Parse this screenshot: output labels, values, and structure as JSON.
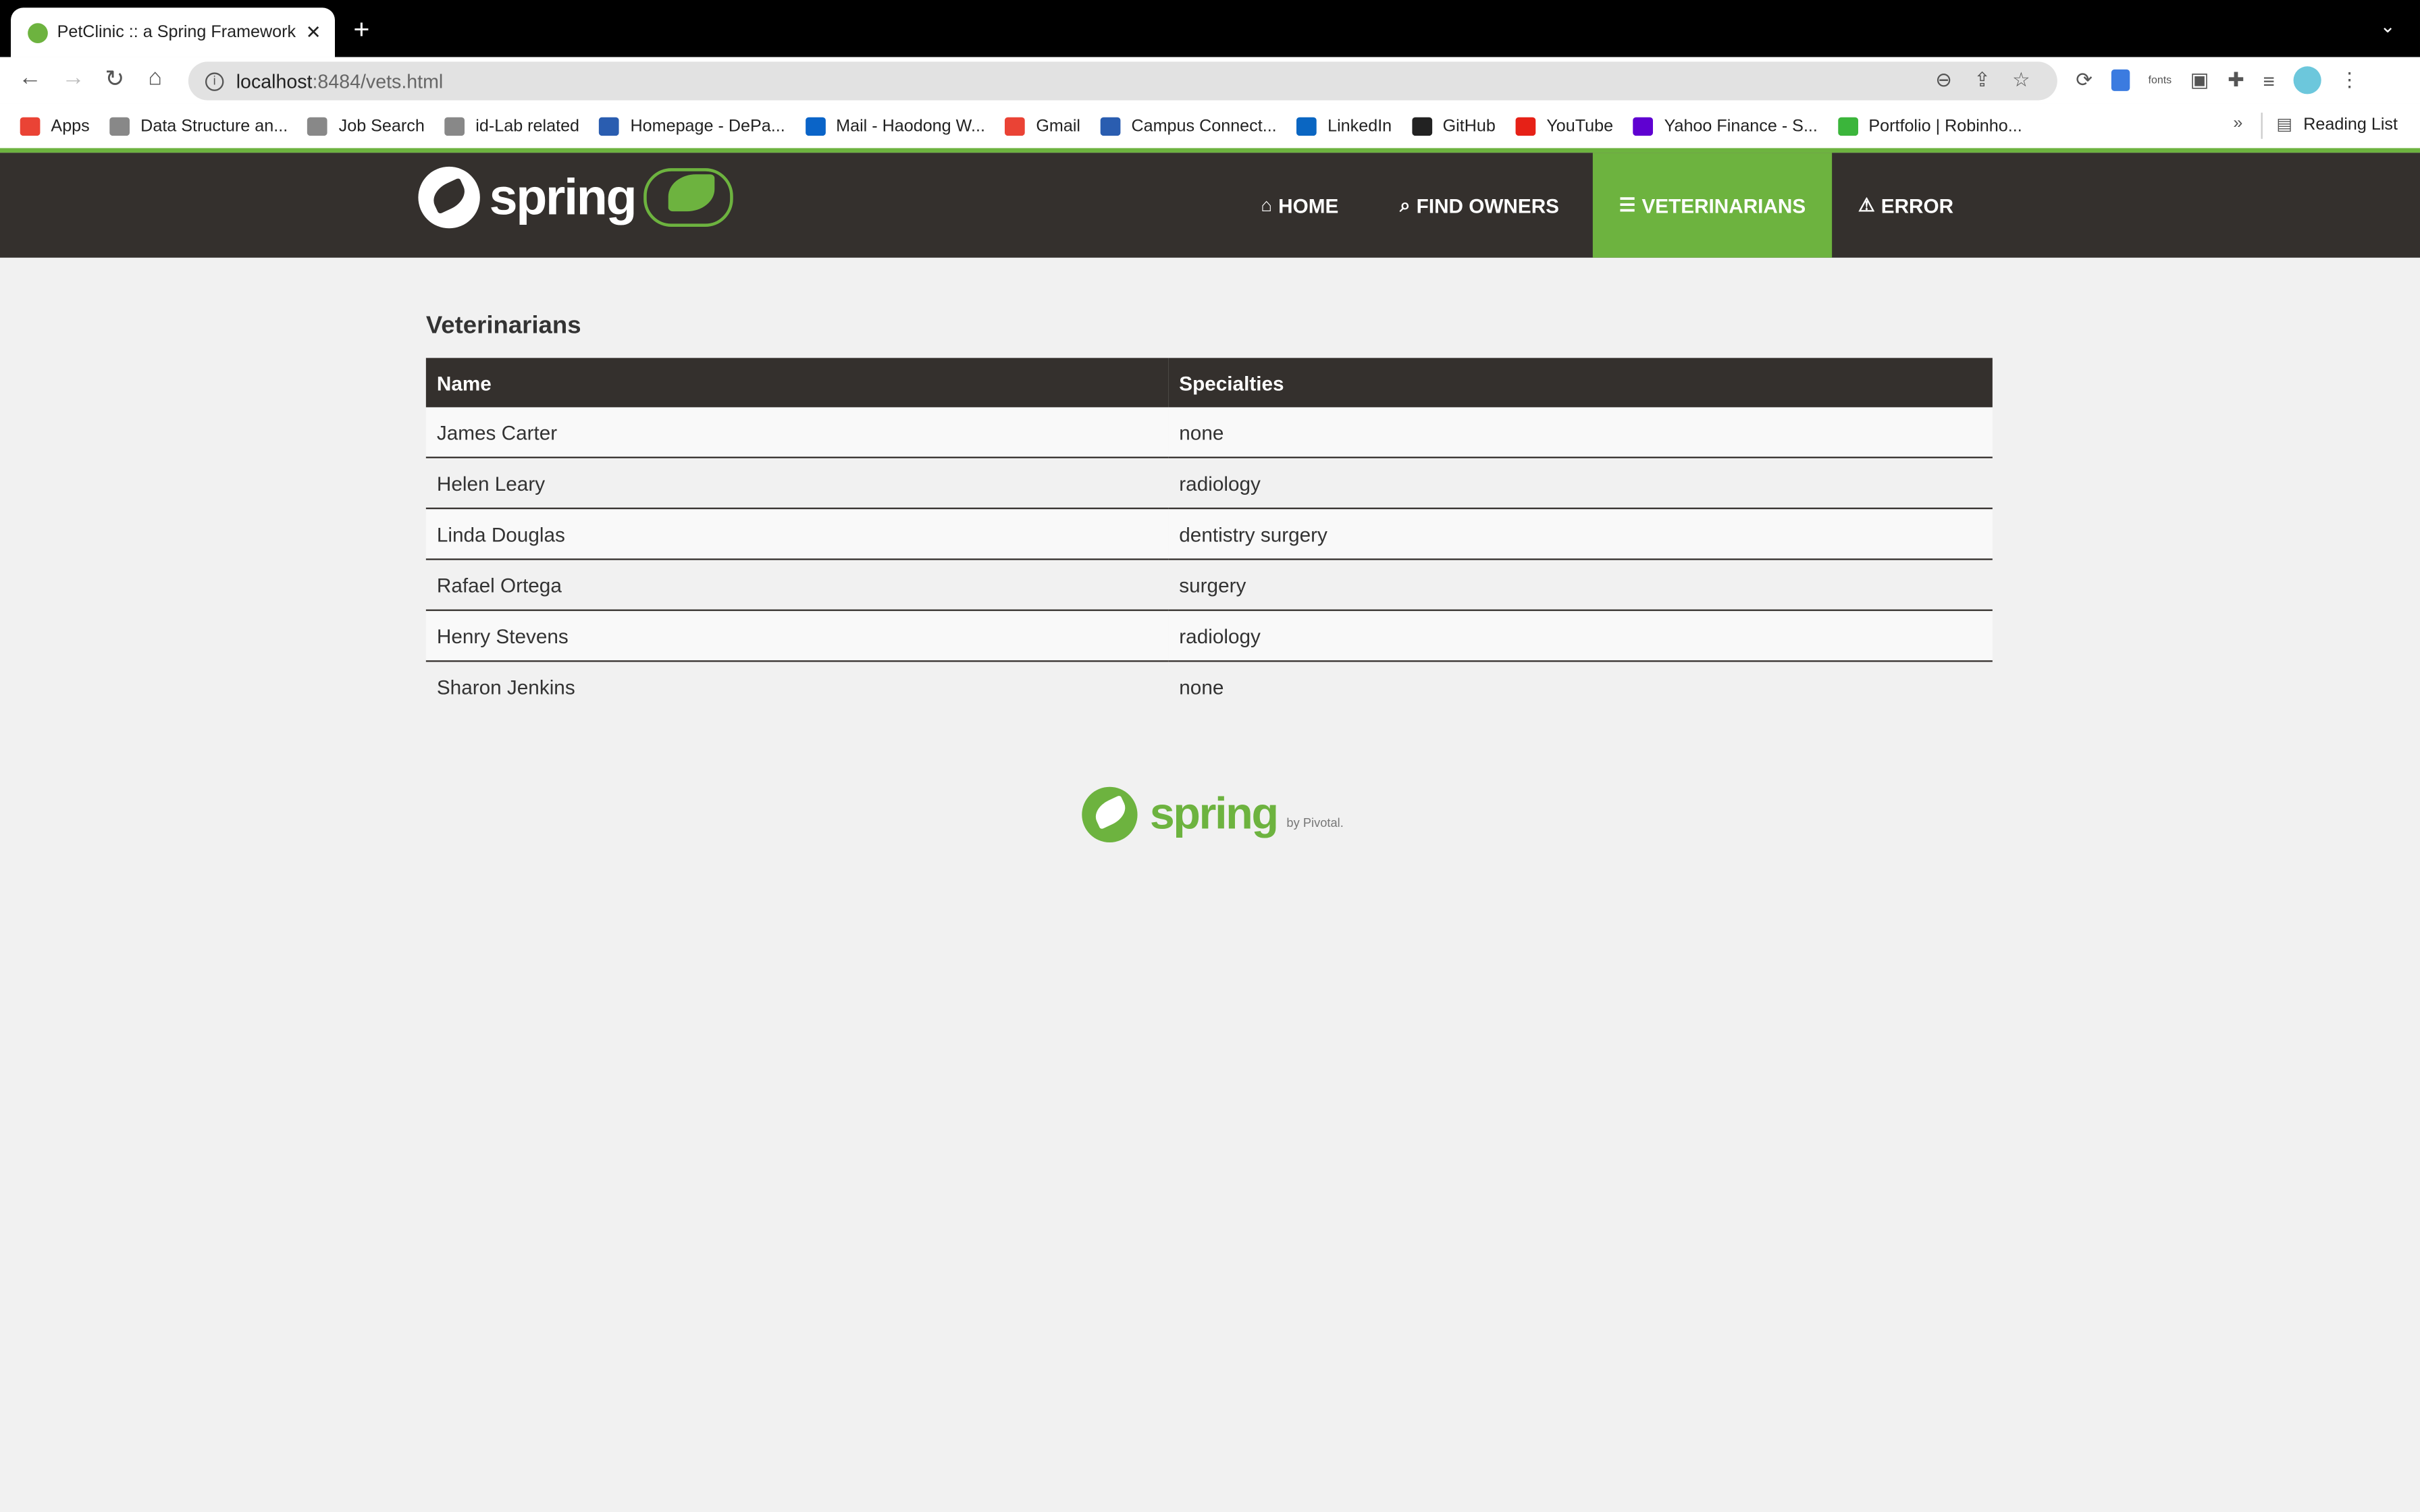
{
  "browser": {
    "tab_title": "PetClinic :: a Spring Framework demonstration",
    "url_host": "localhost",
    "url_path": ":8484/vets.html",
    "extension_label": "fonts",
    "bookmarks": [
      "Apps",
      "Data Structure an...",
      "Job Search",
      "id-Lab related",
      "Homepage - DePa...",
      "Mail - Haodong W...",
      "Gmail",
      "Campus Connect...",
      "LinkedIn",
      "GitHub",
      "YouTube",
      "Yahoo Finance - S...",
      "Portfolio | Robinho..."
    ],
    "bookmark_colors": [
      "#ea4335",
      "#888",
      "#888",
      "#888",
      "#2a5db0",
      "#0a64c8",
      "#ea4335",
      "#2a5db0",
      "#0a66c2",
      "#222",
      "#e62117",
      "#5f01d1",
      "#3bb53b"
    ],
    "overflow": "»",
    "reading_list": "Reading List"
  },
  "header": {
    "logo_text": "spring",
    "nav": [
      {
        "label": "HOME",
        "icon": "home-icon",
        "active": false
      },
      {
        "label": "FIND OWNERS",
        "icon": "search-icon",
        "active": false
      },
      {
        "label": "VETERINARIANS",
        "icon": "list-icon",
        "active": true
      },
      {
        "label": "ERROR",
        "icon": "warning-icon",
        "active": false
      }
    ]
  },
  "main": {
    "title": "Veterinarians",
    "columns": [
      "Name",
      "Specialties"
    ],
    "rows": [
      [
        "James Carter",
        "none"
      ],
      [
        "Helen Leary",
        "radiology"
      ],
      [
        "Linda Douglas",
        "dentistry surgery"
      ],
      [
        "Rafael Ortega",
        "surgery"
      ],
      [
        "Henry Stevens",
        "radiology"
      ],
      [
        "Sharon Jenkins",
        "none"
      ]
    ]
  },
  "footer": {
    "logo_text": "spring",
    "by": "by Pivotal."
  },
  "colors": {
    "brand_green": "#6db33f",
    "nav_dark": "#34302d",
    "background": "#f1f1f1"
  }
}
